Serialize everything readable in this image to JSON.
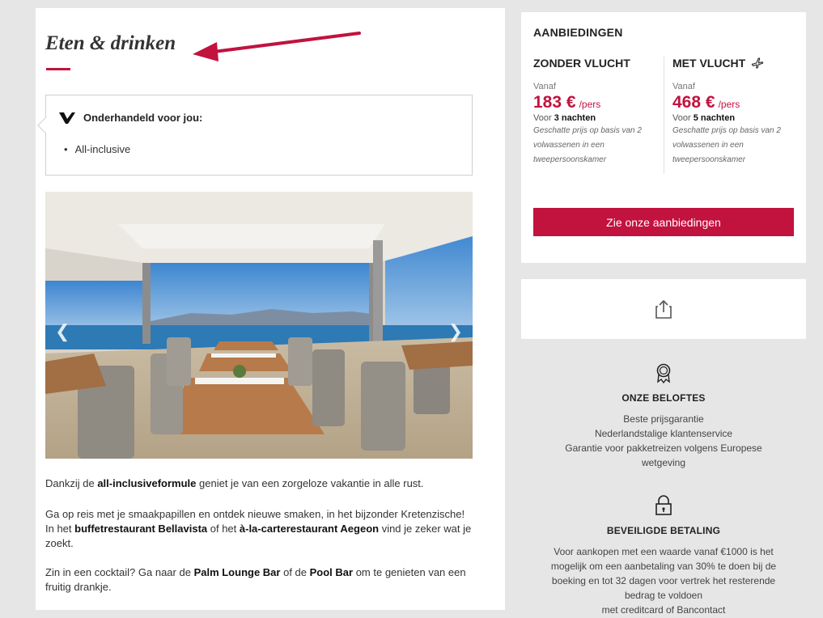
{
  "section": {
    "title": "Eten & drinken"
  },
  "deal": {
    "title": "Onderhandeld voor jou:",
    "items": [
      "All-inclusive"
    ],
    "logo_icon": "v-logo-icon"
  },
  "gallery": {
    "prev_icon": "chevron-left-icon",
    "next_icon": "chevron-right-icon"
  },
  "text": {
    "p1": {
      "pre": "Dankzij de ",
      "b1": "all-inclusiveformule",
      "post": " geniet je van een zorgeloze vakantie in alle rust."
    },
    "p2": {
      "l1": "Ga op reis met je smaakpapillen en ontdek nieuwe smaken, in het bijzonder Kretenzische!",
      "pre": "In het ",
      "b1": "buffetrestaurant Bellavista",
      "mid": " of het ",
      "b2": "à-la-carterestaurant Aegeon",
      "post": " vind je zeker wat je zoekt."
    },
    "p3": {
      "pre": "Zin in een cocktail? Ga naar de ",
      "b1": "Palm Lounge Bar",
      "mid": " of de ",
      "b2": "Pool Bar",
      "post": " om te genieten van een fruitig drankje."
    }
  },
  "offers": {
    "title": "AANBIEDINGEN",
    "no_flight": {
      "title": "ZONDER VLUCHT",
      "from": "Vanaf",
      "price": "183 €",
      "per": "/pers",
      "nights_pre": "Voor ",
      "nights": "3 nachten",
      "note": "Geschatte prijs op basis van 2 volwassenen in een tweepersoonskamer"
    },
    "with_flight": {
      "title": "MET VLUCHT",
      "from": "Vanaf",
      "price": "468 €",
      "per": "/pers",
      "nights_pre": "Voor ",
      "nights": "5 nachten",
      "note": "Geschatte prijs op basis van 2 volwassenen in een tweepersoonskamer"
    },
    "cta": "Zie onze aanbiedingen"
  },
  "promises": {
    "title": "ONZE BELOFTES",
    "lines": [
      "Beste prijsgarantie",
      "Nederlandstalige klantenservice",
      "Garantie voor pakketreizen volgens Europese",
      "wetgeving"
    ]
  },
  "payment": {
    "title": "BEVEILIGDE BETALING",
    "lines": [
      "Voor aankopen met een waarde vanaf €1000 is het",
      "mogelijk om een aanbetaling van 30% te doen bij de",
      "boeking en tot 32 dagen voor vertrek het resterende",
      "bedrag te voldoen",
      "met creditcard of Bancontact"
    ]
  },
  "colors": {
    "accent": "#c2123e",
    "background": "#e6e6e6"
  }
}
